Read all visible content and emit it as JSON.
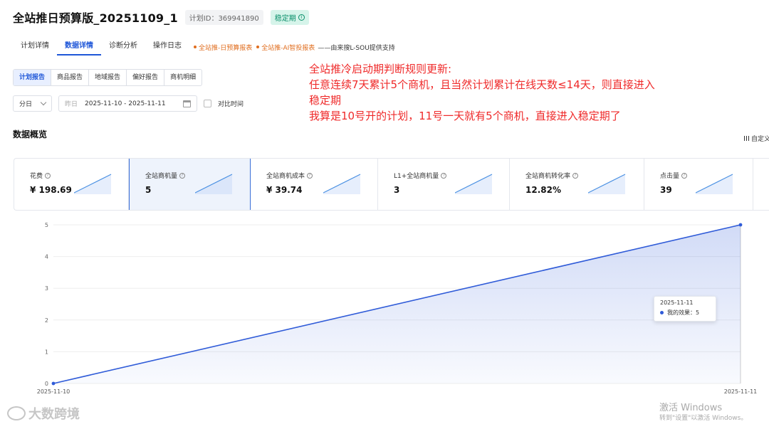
{
  "header": {
    "title": "全站推日预算版_20251109_1",
    "plan_id": "计划ID：369941890",
    "stage": "稳定期"
  },
  "tabs": {
    "items": [
      {
        "label": "计划详情",
        "active": false
      },
      {
        "label": "数据详情",
        "active": true
      },
      {
        "label": "诊断分析",
        "active": false
      },
      {
        "label": "操作日志",
        "active": false
      }
    ],
    "link1": "全站推-日预算报表",
    "link2": "全站推-AI智投报表",
    "note": "——由来搜L-SOU提供支持"
  },
  "subtabs": {
    "items": [
      {
        "label": "计划报告",
        "active": true
      },
      {
        "label": "商品报告",
        "active": false
      },
      {
        "label": "地域报告",
        "active": false
      },
      {
        "label": "偏好报告",
        "active": false
      },
      {
        "label": "商机明细",
        "active": false
      }
    ]
  },
  "filters": {
    "granularity": "分日",
    "date_prefix": "昨日",
    "date_range": "2025-11-10 - 2025-11-11",
    "compare_label": "对比时间"
  },
  "annotation": {
    "lines": [
      "全站推冷启动期判断规则更新:",
      "任意连续7天累计5个商机，且当然计划累计在线天数≤14天，则直接进入",
      "稳定期",
      "我算是10号开的计划，11号一天就有5个商机，直接进入稳定期了"
    ]
  },
  "overview": {
    "title": "数据概览",
    "custom_label": "自定义"
  },
  "metrics": [
    {
      "label": "花费",
      "value": "¥ 198.69",
      "active": false
    },
    {
      "label": "全站商机量",
      "value": "5",
      "active": true
    },
    {
      "label": "全站商机成本",
      "value": "¥ 39.74",
      "active": false
    },
    {
      "label": "L1+全站商机量",
      "value": "3",
      "active": false
    },
    {
      "label": "全站商机转化率",
      "value": "12.82%",
      "active": false
    },
    {
      "label": "点击量",
      "value": "39",
      "active": false
    }
  ],
  "chart_data": {
    "type": "area",
    "x": [
      "2025-11-10",
      "2025-11-11"
    ],
    "series": [
      {
        "name": "我的效果",
        "values": [
          0,
          5
        ]
      }
    ],
    "y_ticks": [
      0,
      1,
      2,
      3,
      4,
      5
    ],
    "ylim": [
      0,
      5
    ],
    "color": "#2f5bd8",
    "grid": true
  },
  "tooltip": {
    "date": "2025-11-11",
    "text": "我的效果：5"
  },
  "watermark": {
    "brand": "大数跨境",
    "win_title": "激活 Windows",
    "win_sub": "转到\"设置\"以激活 Windows。"
  }
}
